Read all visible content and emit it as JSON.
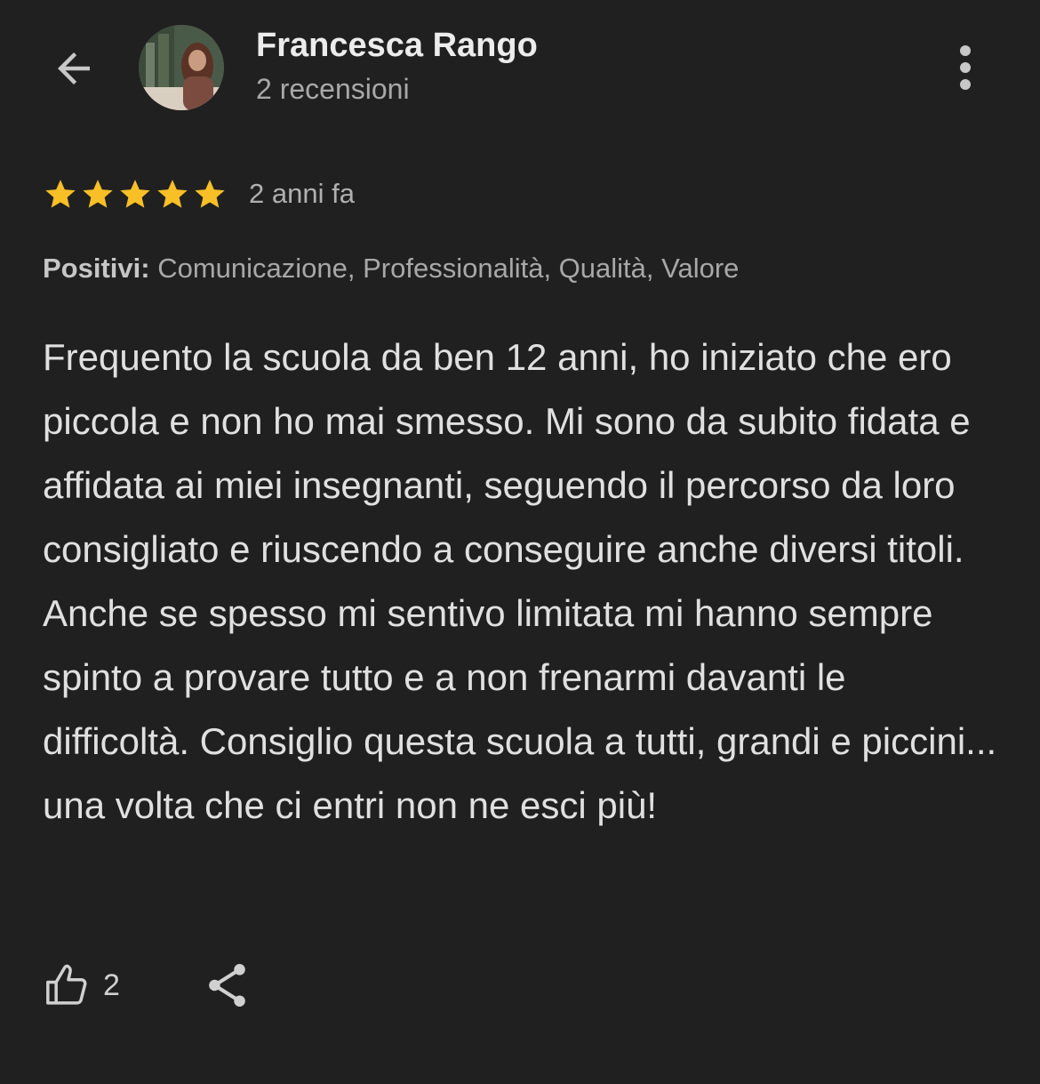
{
  "header": {
    "back_icon": "arrow-back-icon",
    "reviewer_name": "Francesca Rango",
    "reviewer_review_count": "2 recensioni",
    "more_icon": "more-vertical-icon"
  },
  "review": {
    "rating": 5,
    "rating_max": 5,
    "star_color": "#f8bf27",
    "time_ago": "2 anni fa",
    "positives_label": "Positivi:",
    "positives_values": "Comunicazione, Professionalità, Qualità, Valore",
    "text": "Frequento la scuola da ben 12 anni, ho iniziato che ero piccola e non ho mai smesso. Mi sono da subito fidata e affidata ai miei insegnanti, seguendo il percorso da loro consigliato e riuscendo a conseguire anche diversi titoli. Anche se spesso mi sentivo limitata mi hanno sempre spinto a provare tutto e a non frenarmi davanti le difficoltà. Consiglio questa scuola a tutti, grandi e piccini... una volta che ci entri non ne esci più!"
  },
  "actions": {
    "like_icon": "thumbs-up-icon",
    "like_count": "2",
    "share_icon": "share-icon"
  },
  "colors": {
    "background": "#202020",
    "text_primary": "#e0e0e0",
    "text_secondary": "#a8a8a8"
  }
}
